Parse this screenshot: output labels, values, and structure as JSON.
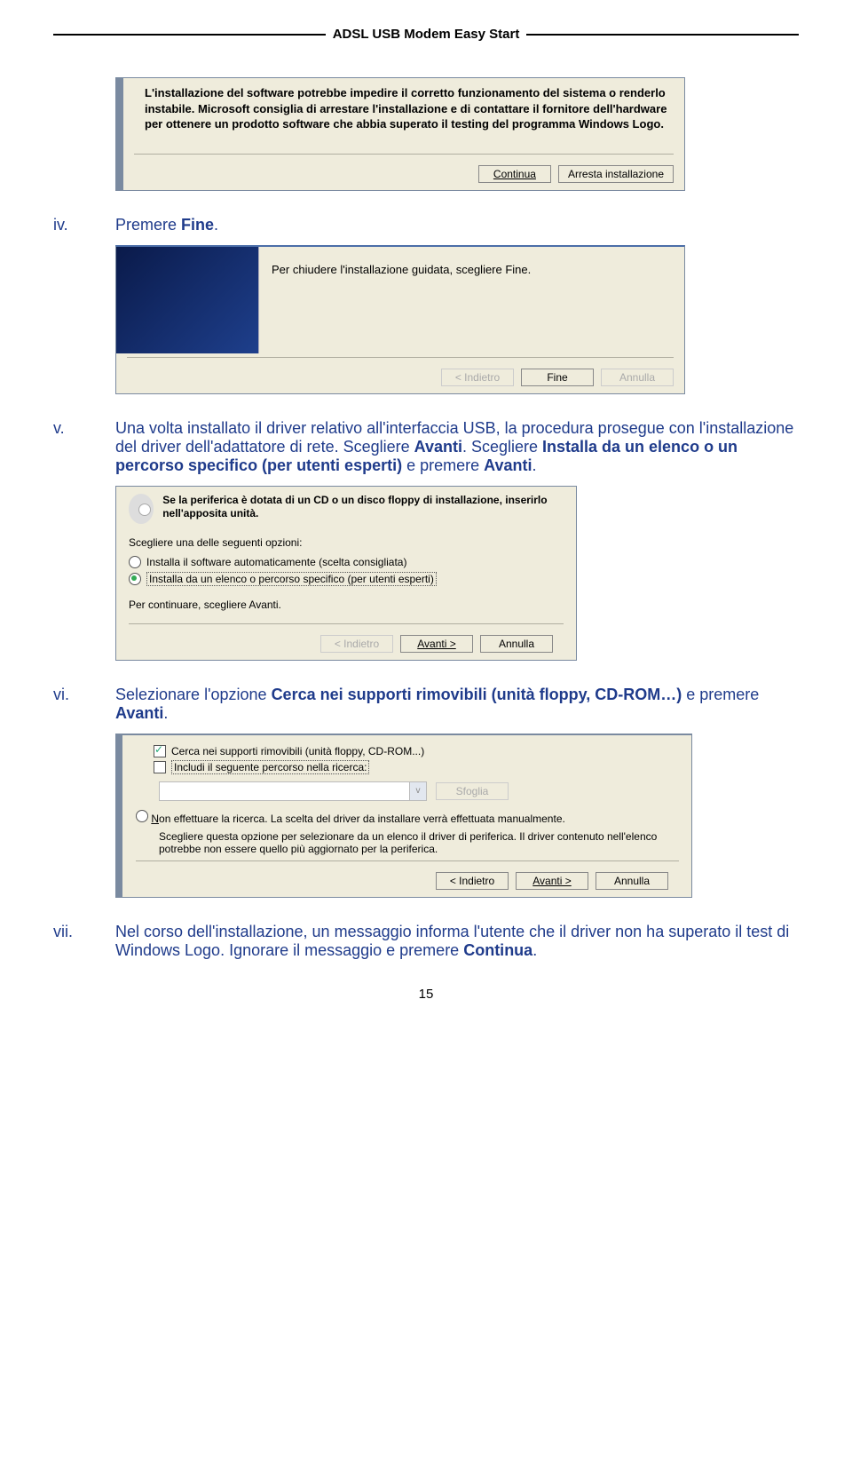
{
  "header": {
    "title": "ADSL USB Modem Easy Start"
  },
  "page_number": "15",
  "step_iv": {
    "marker": "iv.",
    "prefix": "Premere ",
    "keyword": "Fine",
    "suffix": "."
  },
  "step_v": {
    "marker": "v.",
    "t1": "Una volta installato il driver relativo all'interfaccia USB, la procedura prosegue con l'installazione del driver dell'adattatore di rete. Scegliere ",
    "k1": "Avanti",
    "t2": ". Scegliere ",
    "k2": "Installa da un elenco o un percorso specifico (per utenti esperti)",
    "t3": " e premere ",
    "k3": "Avanti",
    "t4": "."
  },
  "step_vi": {
    "marker": "vi.",
    "t1": "Selezionare l'opzione ",
    "k1": "Cerca nei supporti rimovibili (unità floppy, CD-ROM…)",
    "t2": " e premere ",
    "k2": "Avanti",
    "t3": "."
  },
  "step_vii": {
    "marker": "vii.",
    "t1": "Nel corso dell'installazione, un messaggio informa l'utente che il driver non ha superato il test di Windows Logo. Ignorare il messaggio e premere ",
    "k1": "Continua",
    "t2": "."
  },
  "dlg1": {
    "msg": "L'installazione del software potrebbe impedire il corretto funzionamento del sistema o renderlo instabile. Microsoft consiglia di arrestare l'installazione e di contattare il fornitore dell'hardware per ottenere un prodotto software che abbia superato il testing del programma Windows Logo.",
    "btn_continue": "Continua",
    "btn_stop": "Arresta installazione"
  },
  "dlg2": {
    "text": "Per chiudere l'installazione guidata, scegliere Fine.",
    "btn_back": "< Indietro",
    "btn_finish": "Fine",
    "btn_cancel": "Annulla"
  },
  "dlg3": {
    "intro": "Se la periferica è dotata di un CD o un disco floppy di installazione, inserirlo nell'apposita unità.",
    "choose": "Scegliere una delle seguenti opzioni:",
    "opt1": "Installa il software automaticamente (scelta consigliata)",
    "opt2": "Installa da un elenco o percorso specifico (per utenti esperti)",
    "cont": "Per continuare, scegliere Avanti.",
    "btn_back": "< Indietro",
    "btn_next": "Avanti >",
    "btn_cancel": "Annulla"
  },
  "dlg4": {
    "chk1": "Cerca nei supporti rimovibili (unità floppy, CD-ROM...)",
    "chk2": "Includi il seguente percorso nella ricerca:",
    "btn_browse": "Sfoglia",
    "opt_no": "Non effettuare la ricerca. La scelta del driver da installare verrà effettuata manualmente.",
    "sub": "Scegliere questa opzione per selezionare da un elenco il driver di periferica. Il driver contenuto nell'elenco potrebbe non essere quello più aggiornato per la periferica.",
    "btn_back": "< Indietro",
    "btn_next": "Avanti >",
    "btn_cancel": "Annulla"
  }
}
